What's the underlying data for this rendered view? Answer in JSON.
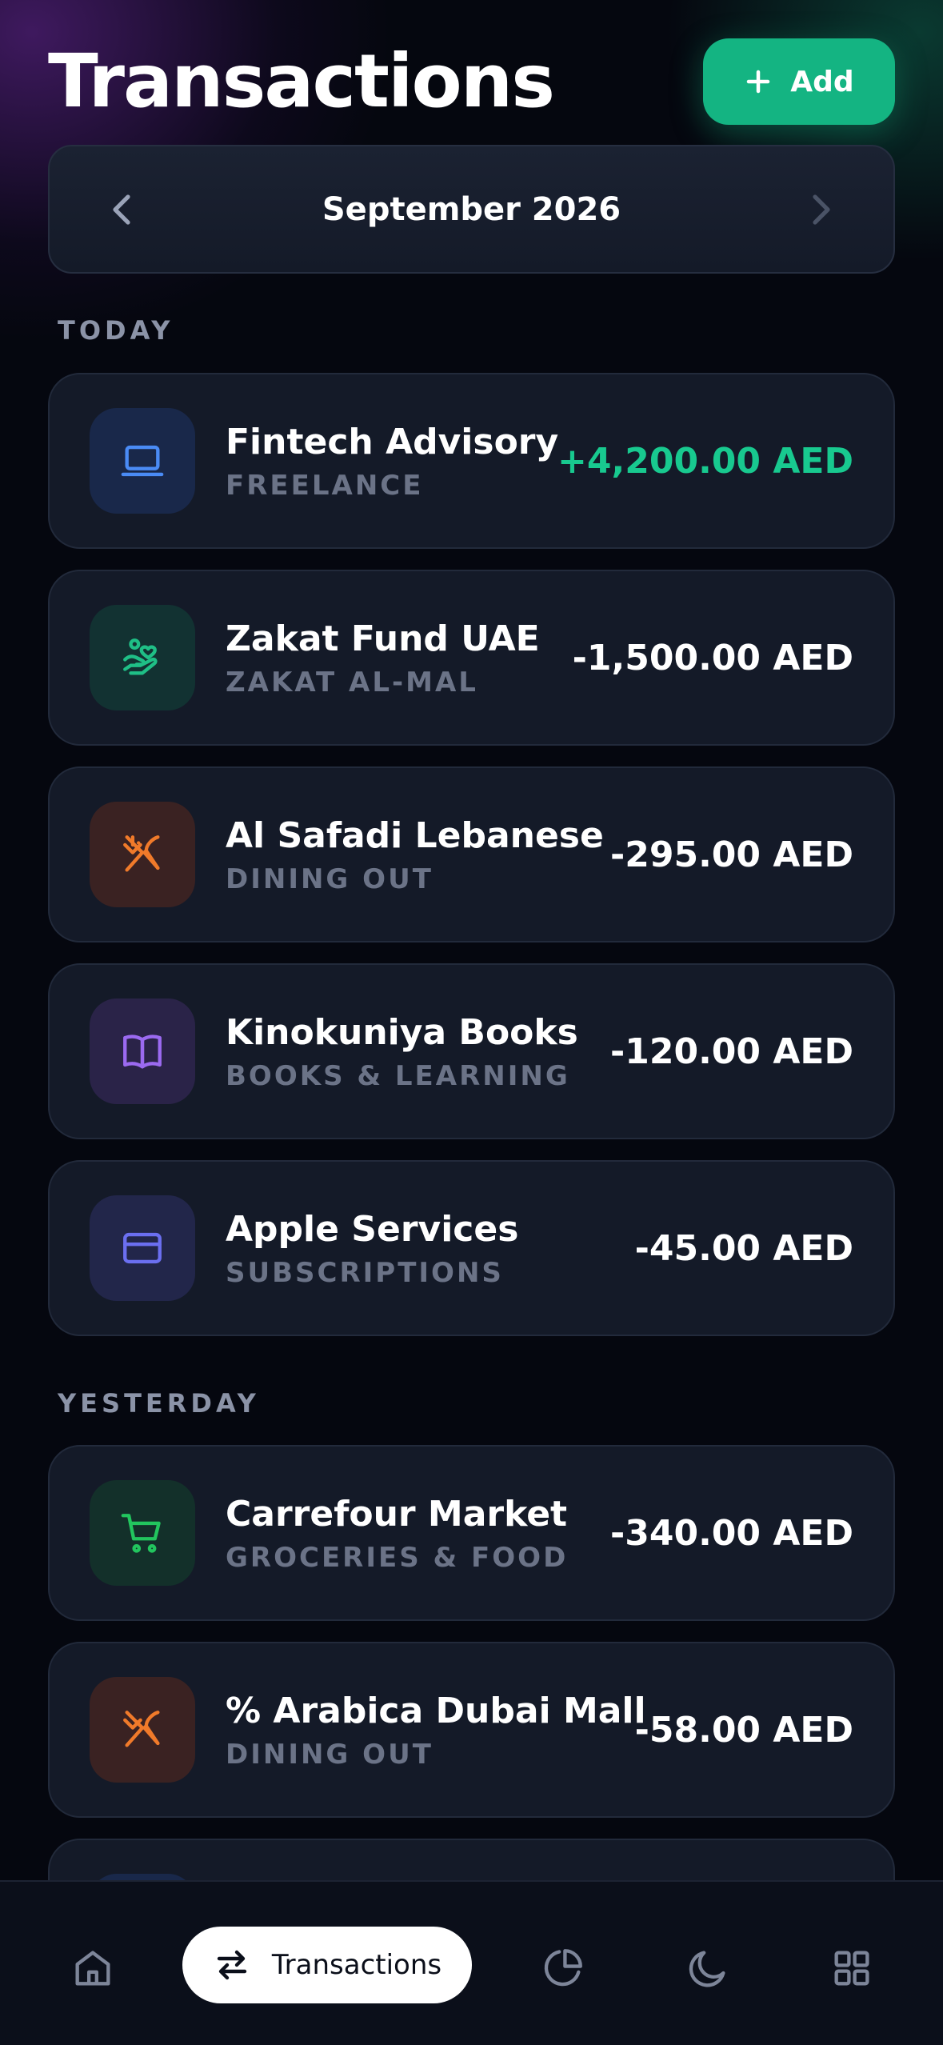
{
  "header": {
    "title": "Transactions",
    "add_label": "Add"
  },
  "month_nav": {
    "label": "September 2026"
  },
  "sections": [
    {
      "label": "TODAY",
      "transactions": [
        {
          "name": "Fintech Advisory",
          "category": "FREELANCE",
          "amount": "+4,200.00 AED",
          "icon": "laptop-icon"
        },
        {
          "name": "Zakat Fund UAE",
          "category": "ZAKAT AL-MAL",
          "amount": "-1,500.00 AED",
          "icon": "hand-heart-icon"
        },
        {
          "name": "Al Safadi Lebanese",
          "category": "DINING OUT",
          "amount": "-295.00 AED",
          "icon": "utensils-icon"
        },
        {
          "name": "Kinokuniya Books",
          "category": "BOOKS & LEARNING",
          "amount": "-120.00 AED",
          "icon": "book-icon"
        },
        {
          "name": "Apple Services",
          "category": "SUBSCRIPTIONS",
          "amount": "-45.00 AED",
          "icon": "credit-card-icon"
        }
      ]
    },
    {
      "label": "YESTERDAY",
      "transactions": [
        {
          "name": "Carrefour Market",
          "category": "GROCERIES & FOOD",
          "amount": "-340.00 AED",
          "icon": "cart-icon"
        },
        {
          "name": "% Arabica Dubai Mall",
          "category": "DINING OUT",
          "amount": "-58.00 AED",
          "icon": "utensils-icon"
        }
      ]
    }
  ],
  "bottom_nav": {
    "active_label": "Transactions",
    "items": [
      "home-icon",
      "transfer-icon",
      "pie-chart-icon",
      "moon-icon",
      "grid-icon"
    ]
  },
  "colors": {
    "accent": "#14b482",
    "positive": "#18c98f",
    "card": "#141a28",
    "background": "#05070f"
  }
}
